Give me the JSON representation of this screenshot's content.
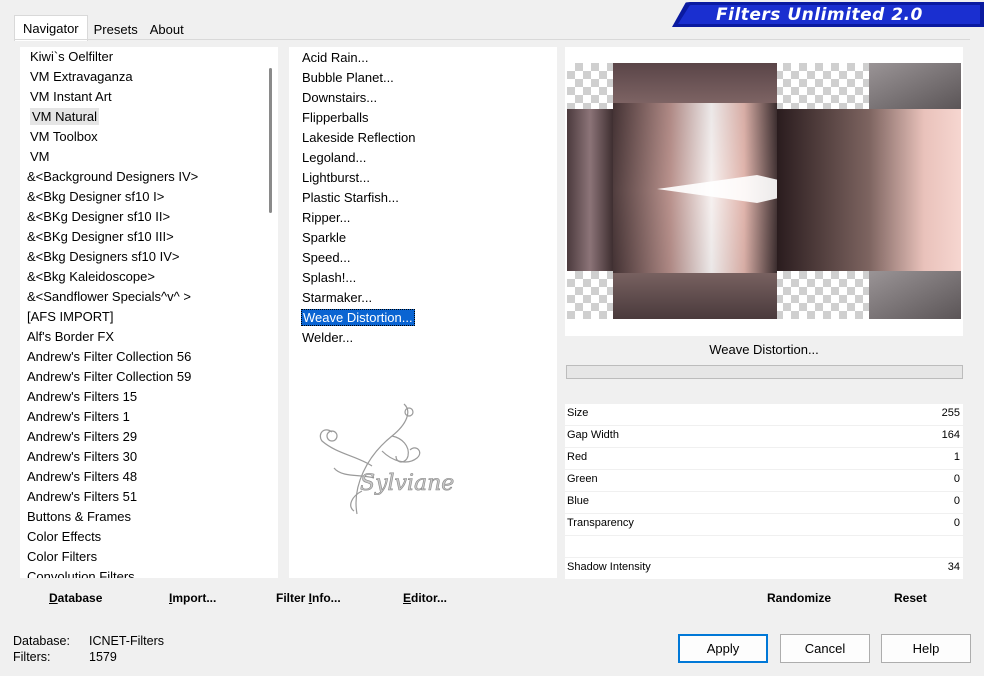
{
  "banner": {
    "title": "Filters Unlimited 2.0"
  },
  "tabs": [
    "Navigator",
    "Presets",
    "About"
  ],
  "categories": [
    "Kiwi`s Oelfilter",
    "VM Extravaganza",
    "VM Instant Art",
    "VM Natural",
    "VM Toolbox",
    "VM",
    "&<Background Designers IV>",
    "&<Bkg Designer sf10 I>",
    "&<BKg Designer sf10 II>",
    "&<BKg Designer sf10 III>",
    "&<Bkg Designers sf10 IV>",
    "&<Bkg Kaleidoscope>",
    "&<Sandflower Specials^v^ >",
    "[AFS IMPORT]",
    "Alf's Border FX",
    "Andrew's Filter Collection 56",
    "Andrew's Filter Collection 59",
    "Andrew's Filters 15",
    "Andrew's Filters 1",
    "Andrew's Filters 29",
    "Andrew's Filters 30",
    "Andrew's Filters 48",
    "Andrew's Filters 51",
    "Buttons & Frames",
    "Color Effects",
    "Color Filters",
    "Convolution Filters"
  ],
  "filters": [
    "Acid Rain...",
    "Bubble Planet...",
    "Downstairs...",
    "Flipperballs",
    "Lakeside Reflection",
    "Legoland...",
    "Lightburst...",
    "Plastic Starfish...",
    "Ripper...",
    "Sparkle",
    "Speed...",
    "Splash!...",
    "Starmaker...",
    "Weave Distortion...",
    "Welder..."
  ],
  "selected_filter": "Weave Distortion...",
  "watermark": "Sylviane",
  "preview": {
    "filter_name": "Weave Distortion..."
  },
  "params": [
    {
      "label": "Size",
      "value": "255"
    },
    {
      "label": "Gap Width",
      "value": "164"
    },
    {
      "label": "Red",
      "value": "1"
    },
    {
      "label": "Green",
      "value": "0"
    },
    {
      "label": "Blue",
      "value": "0"
    },
    {
      "label": "Transparency",
      "value": "0"
    },
    {
      "label": "",
      "value": ""
    },
    {
      "label": "Shadow Intensity",
      "value": "34"
    }
  ],
  "left_buttons": {
    "database": {
      "pre": "",
      "u": "D",
      "post": "atabase"
    },
    "import": {
      "pre": "",
      "u": "I",
      "post": "mport..."
    },
    "filter_info": {
      "pre": "Filter ",
      "u": "I",
      "post": "nfo..."
    },
    "editor": {
      "pre": "",
      "u": "E",
      "post": "ditor..."
    }
  },
  "right_buttons": {
    "randomize": "Randomize",
    "reset": "Reset"
  },
  "info": {
    "database_label": "Database:",
    "database_value": "ICNET-Filters",
    "filters_label": "Filters:",
    "filters_value": "1579"
  },
  "dialog_buttons": {
    "apply": "Apply",
    "cancel": "Cancel",
    "help": "Help"
  },
  "colors": {
    "selection": "#0a64d2",
    "banner": "#1a2fd0",
    "default_button_border": "#0078d7"
  }
}
